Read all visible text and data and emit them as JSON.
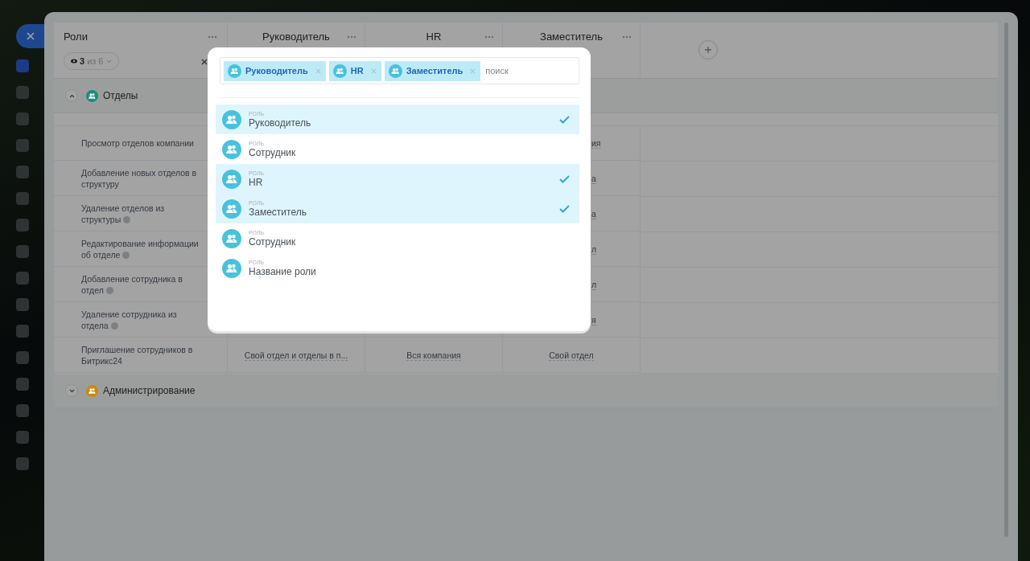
{
  "table": {
    "columns": [
      {
        "title": "Роли"
      },
      {
        "title": "Руководитель"
      },
      {
        "title": "HR"
      },
      {
        "title": "Заместитель"
      }
    ],
    "filter": {
      "count": "3",
      "total": "из 6"
    },
    "sections": [
      {
        "title": "Отделы",
        "expanded": true,
        "color": "#1b8c7a",
        "rows": [
          {
            "label": "Просмотр отделов компании",
            "help": false,
            "deputy": "ия"
          },
          {
            "label": "Добавление новых отделов в структуру",
            "help": false,
            "deputy": "а"
          },
          {
            "label": "Удаление отделов из структуры",
            "help": true,
            "deputy": "а"
          },
          {
            "label": "Редактирование информации об отделе",
            "help": true,
            "deputy": "л"
          },
          {
            "label": "Добавление сотрудника в отдел",
            "help": true,
            "deputy": "л"
          },
          {
            "label": "Удаление сотрудника из отдела",
            "help": true,
            "deputy": "я"
          },
          {
            "label": "Приглашение сотрудников в Битрикс24",
            "help": false,
            "manager": "Свой отдел и отделы в п...",
            "hr": "Вся компания",
            "deputy": "Свой отдел"
          }
        ]
      },
      {
        "title": "Администрирование",
        "expanded": false,
        "color": "#c98a10"
      }
    ]
  },
  "dialog": {
    "tags": [
      {
        "label": "Руководитель"
      },
      {
        "label": "HR"
      },
      {
        "label": "Заместитель"
      }
    ],
    "search": {
      "placeholder": "поиск"
    },
    "items": [
      {
        "caption": "РОЛЬ",
        "name": "Руководитель",
        "selected": true
      },
      {
        "caption": "РОЛЬ",
        "name": "Сотрудник",
        "selected": false
      },
      {
        "caption": "РОЛЬ",
        "name": "HR",
        "selected": true
      },
      {
        "caption": "РОЛЬ",
        "name": "Заместитель",
        "selected": true
      },
      {
        "caption": "РОЛЬ",
        "name": "Сотрудник",
        "selected": false
      },
      {
        "caption": "РОЛЬ",
        "name": "Название роли",
        "selected": false
      }
    ]
  }
}
